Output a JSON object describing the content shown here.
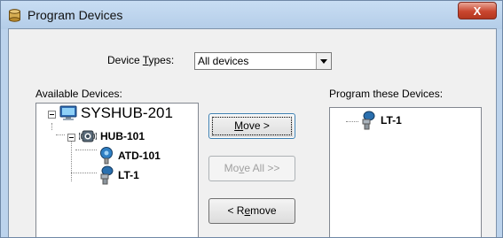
{
  "window": {
    "title": "Program Devices",
    "close_glyph": "X"
  },
  "device_types": {
    "label_pre": "Device ",
    "label_accel": "T",
    "label_post": "ypes:",
    "selected": "All devices"
  },
  "available": {
    "label": "Available Devices:",
    "tree": [
      {
        "name": "SYSHUB-201",
        "icon": "computer-icon"
      },
      {
        "name": "HUB-101",
        "icon": "hub-icon"
      },
      {
        "name": "ATD-101",
        "icon": "sensor-icon"
      },
      {
        "name": "LT-1",
        "icon": "transmitter-icon"
      }
    ]
  },
  "buttons": {
    "move": {
      "accel": "M",
      "rest": "ove >"
    },
    "move_all": {
      "pre": "Mo",
      "accel": "v",
      "rest": "e All >>"
    },
    "remove": {
      "pre": "< R",
      "accel": "e",
      "rest": "move"
    }
  },
  "program": {
    "label": "Program these Devices:",
    "items": [
      {
        "name": "LT-1",
        "icon": "transmitter-icon"
      }
    ]
  }
}
